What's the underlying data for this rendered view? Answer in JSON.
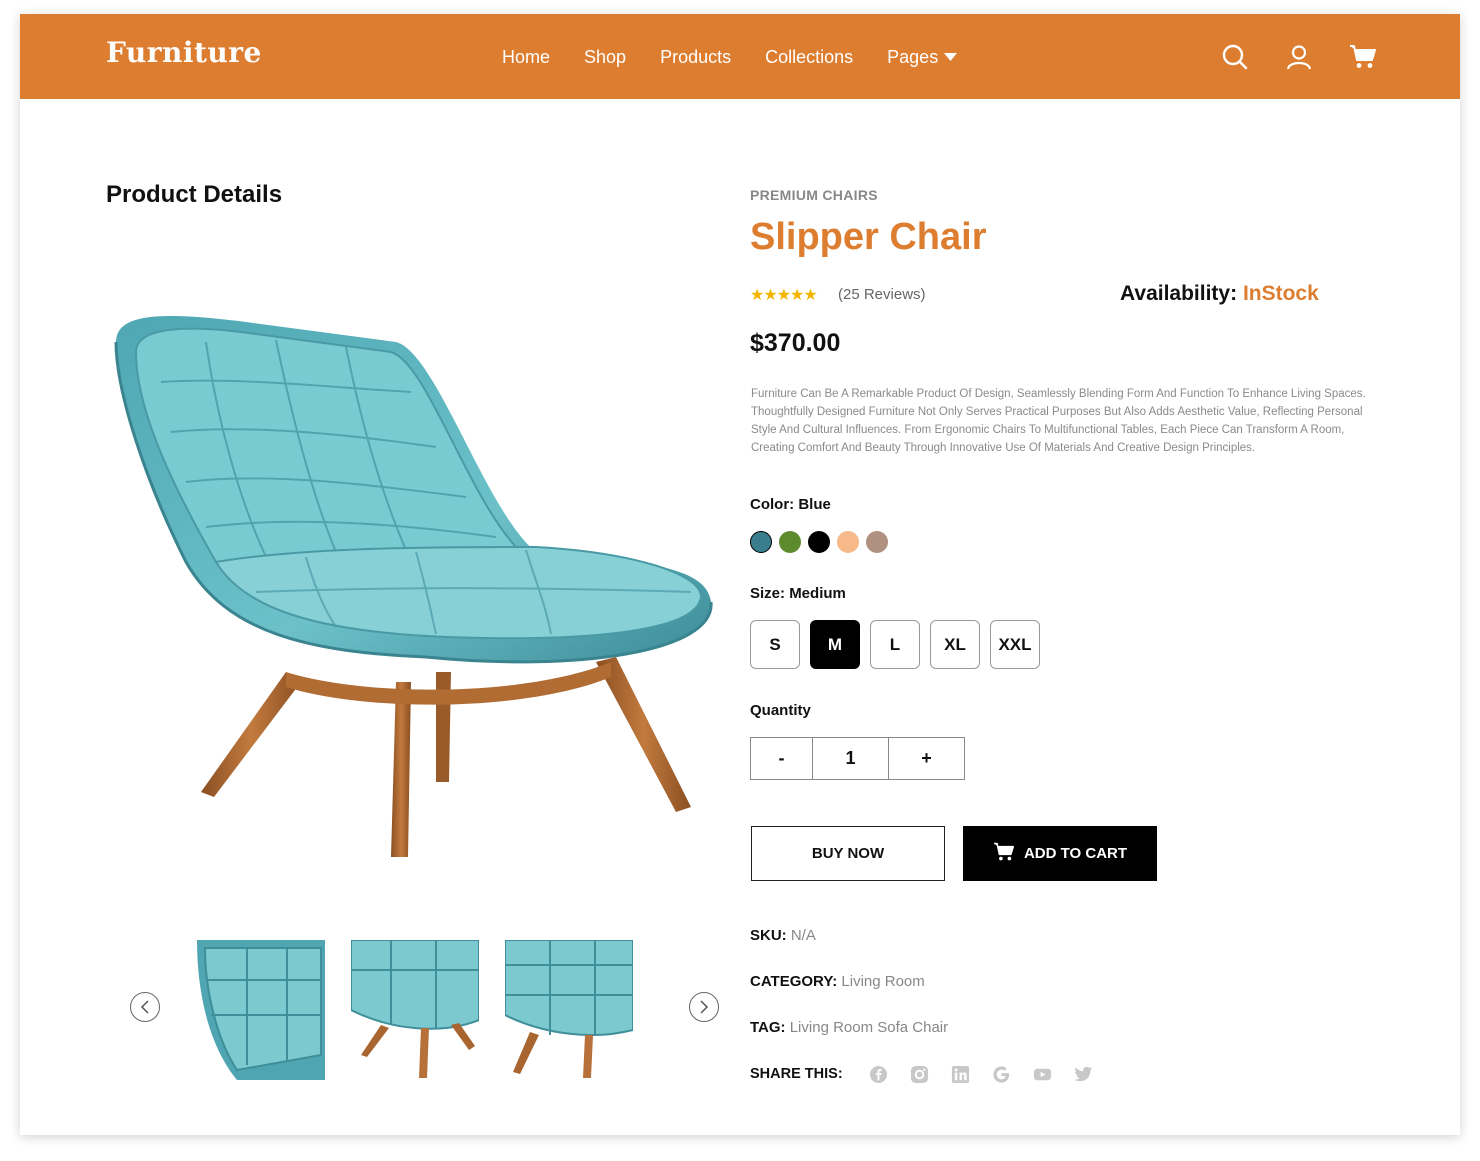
{
  "header": {
    "logo": "Furniture",
    "nav": [
      "Home",
      "Shop",
      "Products",
      "Collections",
      "Pages"
    ],
    "icons": [
      "search-icon",
      "user-icon",
      "cart-icon"
    ],
    "bg_color": "#dd7d30"
  },
  "left": {
    "section_title": "Product Details"
  },
  "product": {
    "category_label": "PREMIUM CHAIRS",
    "title": "Slipper Chair",
    "stars": "★★★★★",
    "rating": 5,
    "reviews": "(25 Reviews)",
    "availability_label": "Availability:",
    "availability_value": "InStock",
    "price": "$370.00",
    "description": "Furniture Can Be A Remarkable Product Of Design, Seamlessly Blending Form And Function To Enhance Living Spaces. Thoughtfully Designed Furniture Not Only Serves Practical Purposes But Also Adds Aesthetic Value, Reflecting Personal Style And Cultural Influences. From Ergonomic Chairs To Multifunctional Tables, Each Piece Can Transform A Room, Creating Comfort And Beauty Through Innovative Use Of Materials And Creative Design Principles.",
    "color_label": "Color:",
    "color_value": "Blue",
    "colors": [
      "#3a7d8c",
      "#5e8a2e",
      "#000000",
      "#f7b98a",
      "#b09080"
    ],
    "size_label": "Size:",
    "size_value": "Medium",
    "sizes": [
      "S",
      "M",
      "L",
      "XL",
      "XXL"
    ],
    "selected_size": "M",
    "quantity_label": "Quantity",
    "qty_minus": "-",
    "quantity": "1",
    "qty_plus": "+",
    "buy_now": "BUY NOW",
    "add_to_cart": "ADD TO CART",
    "sku_label": "SKU:",
    "sku_value": "N/A",
    "category_meta_label": "CATEGORY:",
    "category_meta_value": "Living Room",
    "tag_label": "TAG:",
    "tag_value": "Living Room Sofa Chair",
    "share_label": "SHARE THIS:",
    "share_icons": [
      "facebook-icon",
      "instagram-icon",
      "linkedin-icon",
      "google-icon",
      "youtube-icon",
      "twitter-icon"
    ]
  },
  "accent_color": "#dd7d30"
}
